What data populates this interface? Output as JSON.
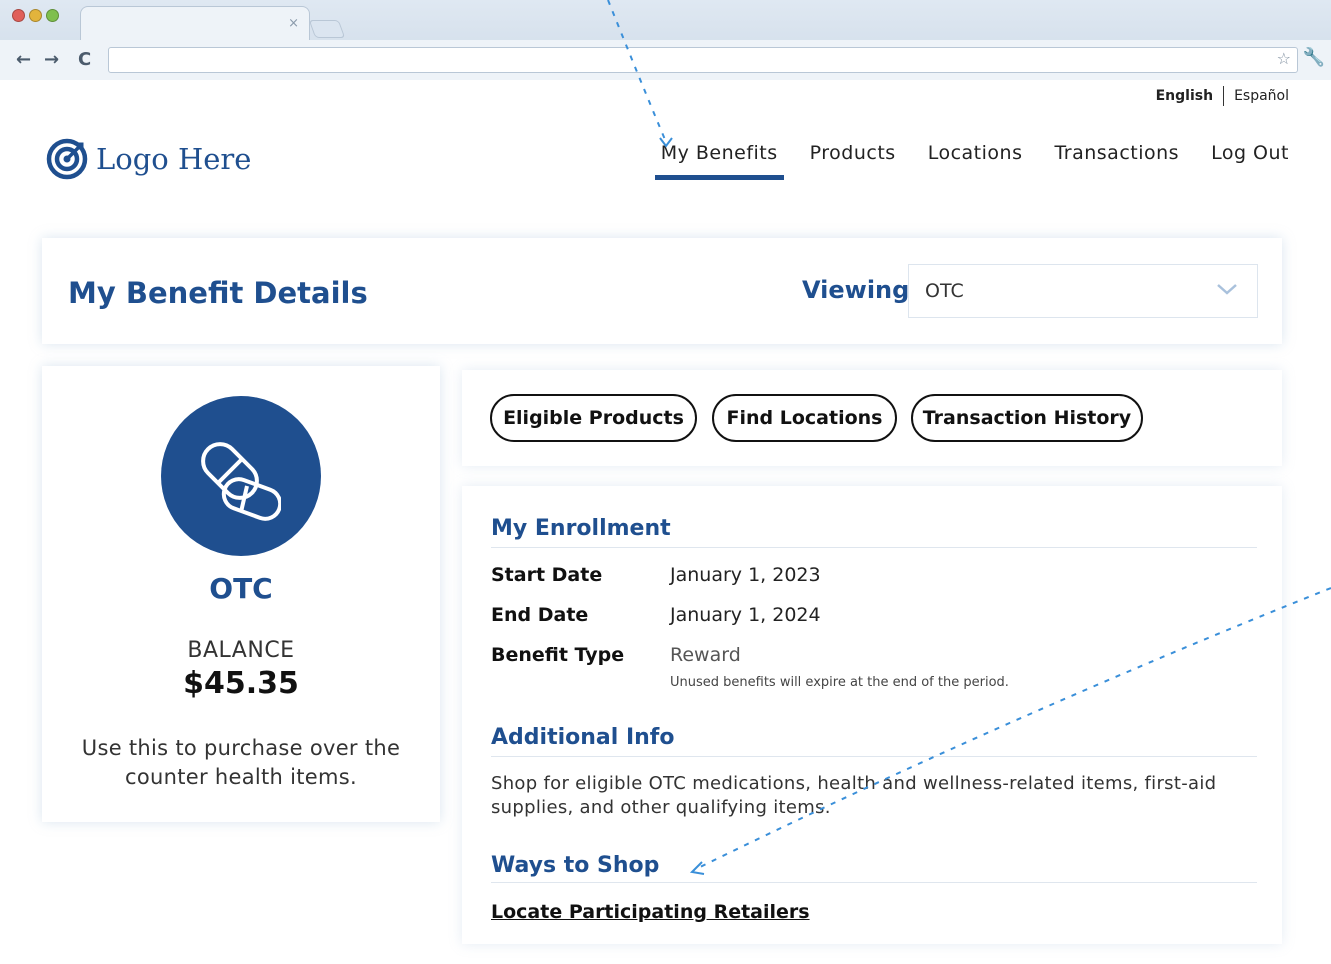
{
  "browser": {
    "tab_close": "×",
    "back": "←",
    "forward": "→",
    "reload": "C"
  },
  "language": {
    "english": "English",
    "espanol": "Español"
  },
  "logo": {
    "text": "Logo Here"
  },
  "nav": {
    "items": [
      {
        "label": "My Benefits",
        "active": true
      },
      {
        "label": "Products"
      },
      {
        "label": "Locations"
      },
      {
        "label": "Transactions"
      },
      {
        "label": "Log Out"
      }
    ]
  },
  "header": {
    "title": "My Benefit Details",
    "viewing_label": "Viewing",
    "viewing_value": "OTC"
  },
  "benefit": {
    "name": "OTC",
    "balance_label": "BALANCE",
    "balance_value": "$45.35",
    "description": "Use this to purchase over the counter health items."
  },
  "actions": {
    "eligible_products": "Eligible Products",
    "find_locations": "Find Locations",
    "transaction_history": "Transaction History"
  },
  "enrollment": {
    "title": "My Enrollment",
    "rows": [
      {
        "label": "Start Date",
        "value": "January 1, 2023"
      },
      {
        "label": "End Date",
        "value": "January 1, 2024"
      },
      {
        "label": "Benefit Type",
        "value": "Reward",
        "note": "Unused benefits will expire at the end of the period."
      }
    ]
  },
  "additional": {
    "title": "Additional Info",
    "text": "Shop for eligible OTC medications, health and wellness-related items, first-aid supplies, and other qualifying items."
  },
  "shop": {
    "title": "Ways to Shop",
    "link": "Locate Participating Retailers"
  },
  "colors": {
    "brand": "#1f4f8f",
    "annotation": "#3a8fd9"
  }
}
